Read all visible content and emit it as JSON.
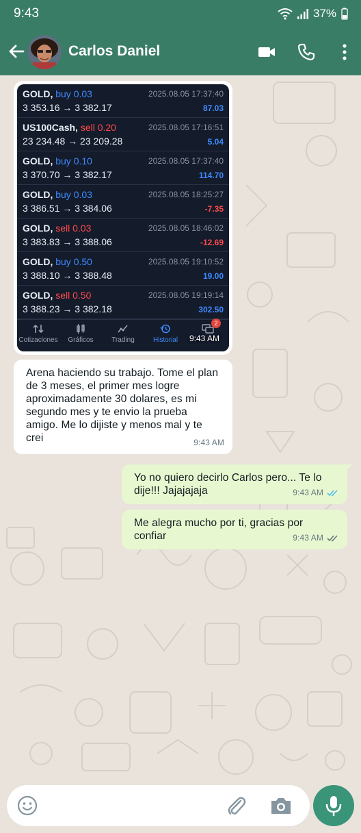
{
  "status_bar": {
    "time": "9:43",
    "battery": "37%"
  },
  "header": {
    "contact_name": "Carlos Daniel"
  },
  "trades": [
    {
      "symbol": "GOLD,",
      "side": "buy 0.03",
      "side_type": "buy",
      "prices": "3 353.16 → 3 382.17",
      "time": "2025.08.05 17:37:40",
      "profit": "87.03",
      "profit_sign": "pos"
    },
    {
      "symbol": "US100Cash,",
      "side": "sell 0.20",
      "side_type": "sell",
      "prices": "23 234.48 → 23 209.28",
      "time": "2025.08.05 17:16:51",
      "profit": "5.04",
      "profit_sign": "pos"
    },
    {
      "symbol": "GOLD,",
      "side": "buy 0.10",
      "side_type": "buy",
      "prices": "3 370.70 → 3 382.17",
      "time": "2025.08.05 17:37:40",
      "profit": "114.70",
      "profit_sign": "pos"
    },
    {
      "symbol": "GOLD,",
      "side": "buy 0.03",
      "side_type": "buy",
      "prices": "3 386.51 → 3 384.06",
      "time": "2025.08.05 18:25:27",
      "profit": "-7.35",
      "profit_sign": "neg"
    },
    {
      "symbol": "GOLD,",
      "side": "sell 0.03",
      "side_type": "sell",
      "prices": "3 383.83 → 3 388.06",
      "time": "2025.08.05 18:46:02",
      "profit": "-12.69",
      "profit_sign": "neg"
    },
    {
      "symbol": "GOLD,",
      "side": "buy 0.50",
      "side_type": "buy",
      "prices": "3 388.10 → 3 388.48",
      "time": "2025.08.05 19:10:52",
      "profit": "19.00",
      "profit_sign": "pos"
    },
    {
      "symbol": "GOLD,",
      "side": "sell 0.50",
      "side_type": "sell",
      "prices": "3 388.23 → 3 382.18",
      "time": "2025.08.05 19:19:14",
      "profit": "302.50",
      "profit_sign": "pos"
    }
  ],
  "trade_tabs": [
    {
      "label": "Cotizaciones",
      "icon": "quotes-icon"
    },
    {
      "label": "Gráficos",
      "icon": "charts-icon"
    },
    {
      "label": "Trading",
      "icon": "trading-icon"
    },
    {
      "label": "Historial",
      "icon": "history-icon",
      "active": true
    }
  ],
  "trade_badge": "2",
  "messages": {
    "image_time": "9:43 AM",
    "incoming_text": "Arena haciendo su trabajo. Tome el plan de 3 meses, el primer mes logre aproximadamente 30 dolares, es mi segundo mes y te envio la prueba amigo. Me lo dijiste y menos mal y te crei",
    "incoming_time": "9:43 AM",
    "outgoing_1_text": "Yo no quiero decirlo Carlos pero... Te lo dije!!! Jajajajaja",
    "outgoing_1_time": "9:43 AM",
    "outgoing_2_text": "Me alegra mucho por ti, gracias por confiar",
    "outgoing_2_time": "9:43 AM"
  },
  "colors": {
    "header": "#3a7d67",
    "outgoing_bubble": "#e7f8d0",
    "read_ticks": "#53bdeb",
    "delivered_ticks": "#667781"
  },
  "composer": {
    "placeholder": ""
  }
}
